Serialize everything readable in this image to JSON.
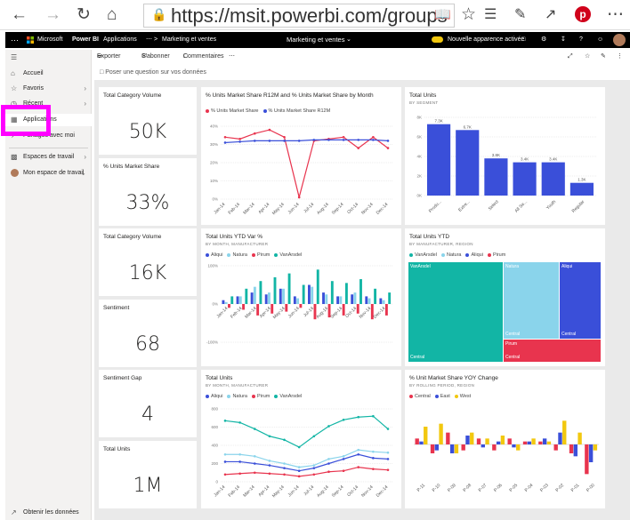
{
  "browser": {
    "url": "https://msit.powerbi.com/groups"
  },
  "topbar": {
    "microsoft": "Microsoft",
    "product": "Power BI",
    "crumb1": "Applications",
    "crumb2": "Marketing et ventes",
    "center_title": "Marketing et ventes",
    "toggle_label": "Nouvelle apparence activée"
  },
  "toolbar": {
    "export": "Exporter",
    "subscribe": "S'abonner",
    "comments": "Commentaires"
  },
  "qa": {
    "placeholder": "Poser une question sur vos données"
  },
  "sidebar": {
    "items": [
      {
        "label": "Accueil"
      },
      {
        "label": "Favoris"
      },
      {
        "label": "Récent"
      },
      {
        "label": "Applications"
      },
      {
        "label": "Partagés avec moi"
      },
      {
        "label": "Espaces de travail"
      },
      {
        "label": "Mon espace de travail"
      }
    ],
    "footer": "Obtenir les données"
  },
  "tiles": {
    "k1": {
      "title": "Total Category Volume",
      "value": "50K"
    },
    "k2": {
      "title": "% Units Market Share",
      "value": "33%"
    },
    "k3": {
      "title": "Total Category Volume",
      "value": "16K"
    },
    "k4": {
      "title": "Sentiment",
      "value": "68"
    },
    "k5": {
      "title": "Sentiment Gap",
      "value": "4"
    },
    "k6": {
      "title": "Total Units",
      "value": "1M"
    },
    "c1": {
      "title": "% Units Market Share R12M and % Units Market Share by Month",
      "legend": [
        "% Units Market Share",
        "% Units Market Share R12M"
      ]
    },
    "c2": {
      "title": "Total Units",
      "subtitle": "BY SEGMENT"
    },
    "c3": {
      "title": "Total Units YTD Var %",
      "subtitle": "BY MONTH, MANUFACTURER",
      "legend": [
        "Aliqui",
        "Natura",
        "Pirum",
        "VanArsdel"
      ]
    },
    "c4": {
      "title": "Total Units YTD",
      "subtitle": "BY MANUFACTURER, REGION",
      "legend": [
        "VanArsdel",
        "Natura",
        "Aliqui",
        "Pirum"
      ]
    },
    "c5": {
      "title": "Total Units",
      "subtitle": "BY MONTH, MANUFACTURER",
      "legend": [
        "Aliqui",
        "Natura",
        "Pirum",
        "VanArsdel"
      ]
    },
    "c6": {
      "title": "% Unit Market Share YOY Change",
      "subtitle": "BY ROLLING PERIOD, REGION",
      "legend": [
        "Central",
        "East",
        "West"
      ]
    }
  },
  "chart_data": [
    {
      "type": "line",
      "title": "% Units Market Share R12M and % Units Market Share by Month",
      "categories": [
        "Jan-14",
        "Feb-14",
        "Mar-14",
        "Apr-14",
        "May-14",
        "Jun-14",
        "Jul-14",
        "Aug-14",
        "Sep-14",
        "Oct-14",
        "Nov-14",
        "Dec-14"
      ],
      "ylim": [
        0,
        40
      ],
      "yticks": [
        "0%",
        "10%",
        "20%",
        "30%",
        "40%"
      ],
      "series": [
        {
          "name": "% Units Market Share",
          "color": "#e8344e",
          "values": [
            34,
            33,
            36,
            38,
            34,
            1,
            32,
            33,
            34,
            28,
            34,
            28
          ]
        },
        {
          "name": "% Units Market Share R12M",
          "color": "#3a4fd9",
          "values": [
            31,
            31.5,
            32,
            32,
            32,
            32,
            32.5,
            32.5,
            32.5,
            32.5,
            32.5,
            32
          ]
        }
      ]
    },
    {
      "type": "bar",
      "title": "Total Units",
      "subtitle": "BY SEGMENT",
      "categories": [
        "Produ...",
        "Extre...",
        "Select",
        "All Se...",
        "Youth",
        "Regular"
      ],
      "values": [
        7.3,
        6.7,
        3.8,
        3.4,
        3.4,
        1.3
      ],
      "data_labels": [
        "7.3K",
        "6.7K",
        "3.8K",
        "3.4K",
        "3.4K",
        "1.3K"
      ],
      "ylim": [
        0,
        8
      ],
      "yticks": [
        "0K",
        "2K",
        "4K",
        "6K",
        "8K"
      ],
      "color": "#3a4fd9"
    },
    {
      "type": "bar",
      "title": "Total Units YTD Var %",
      "subtitle": "BY MONTH, MANUFACTURER",
      "categories": [
        "Jan-14",
        "Feb-14",
        "Mar-14",
        "Apr-14",
        "May-14",
        "Jun-14",
        "Jul-14",
        "Aug-14",
        "Sep-14",
        "Oct-14",
        "Nov-14",
        "Dec-14"
      ],
      "ylim": [
        -100,
        100
      ],
      "yticks": [
        "-100%",
        "0%",
        "100%"
      ],
      "series": [
        {
          "name": "Aliqui",
          "color": "#3a4fd9",
          "values": [
            10,
            20,
            30,
            25,
            40,
            20,
            50,
            30,
            20,
            25,
            20,
            15
          ]
        },
        {
          "name": "Natura",
          "color": "#8ad4eb",
          "values": [
            5,
            20,
            45,
            30,
            40,
            15,
            45,
            25,
            20,
            30,
            15,
            10
          ]
        },
        {
          "name": "Pirum",
          "color": "#e8344e",
          "values": [
            -10,
            -15,
            -30,
            -25,
            -20,
            -10,
            -40,
            -35,
            -30,
            -25,
            -40,
            -30
          ]
        },
        {
          "name": "VanArsdel",
          "color": "#12b5a5",
          "values": [
            20,
            40,
            60,
            70,
            80,
            50,
            90,
            60,
            55,
            65,
            40,
            30
          ]
        }
      ]
    },
    {
      "type": "table",
      "title": "Total Units YTD",
      "subtitle": "BY MANUFACTURER, REGION",
      "treemap": [
        {
          "name": "VanArsdel",
          "color": "#12b5a5",
          "value": 48,
          "region": "Central"
        },
        {
          "name": "Natura",
          "color": "#8ad4eb",
          "value": 24,
          "region": "Central"
        },
        {
          "name": "Aliqui",
          "color": "#3a4fd9",
          "value": 15,
          "region": "Central"
        },
        {
          "name": "Pirum",
          "color": "#e8344e",
          "value": 8,
          "region": "Central"
        }
      ]
    },
    {
      "type": "line",
      "title": "Total Units",
      "subtitle": "BY MONTH, MANUFACTURER",
      "categories": [
        "Jan-14",
        "Feb-14",
        "Mar-14",
        "Apr-14",
        "May-14",
        "Jun-14",
        "Jul-14",
        "Aug-14",
        "Sep-14",
        "Oct-14",
        "Nov-14",
        "Dec-14"
      ],
      "ylim": [
        0,
        800
      ],
      "yticks": [
        "0",
        "200",
        "400",
        "600",
        "800"
      ],
      "series": [
        {
          "name": "Aliqui",
          "color": "#3a4fd9",
          "values": [
            220,
            220,
            200,
            180,
            150,
            120,
            150,
            200,
            250,
            300,
            260,
            250
          ]
        },
        {
          "name": "Natura",
          "color": "#8ad4eb",
          "values": [
            300,
            300,
            280,
            230,
            200,
            160,
            180,
            250,
            280,
            350,
            330,
            320
          ]
        },
        {
          "name": "Pirum",
          "color": "#e8344e",
          "values": [
            80,
            90,
            100,
            90,
            80,
            60,
            80,
            110,
            120,
            160,
            140,
            130
          ]
        },
        {
          "name": "VanArsdel",
          "color": "#12b5a5",
          "values": [
            670,
            650,
            580,
            500,
            460,
            380,
            500,
            610,
            680,
            710,
            720,
            580
          ]
        }
      ]
    },
    {
      "type": "bar",
      "title": "% Unit Market Share YOY Change",
      "subtitle": "BY ROLLING PERIOD, REGION",
      "categories": [
        "P-11",
        "P-10",
        "P-09",
        "P-08",
        "P-07",
        "P-06",
        "P-05",
        "P-04",
        "P-03",
        "P-02",
        "P-01",
        "P-00"
      ],
      "series": [
        {
          "name": "Central",
          "color": "#e8344e",
          "values": [
            2,
            -3,
            4,
            -2,
            2,
            -2,
            2,
            1,
            1,
            -2,
            -3,
            -10
          ]
        },
        {
          "name": "East",
          "color": "#3a4fd9",
          "values": [
            1,
            -2,
            -3,
            3,
            -1,
            1,
            -1,
            1,
            2,
            4,
            -4,
            -6
          ]
        },
        {
          "name": "West",
          "color": "#f2c80f",
          "values": [
            6,
            7,
            -3,
            4,
            2,
            3,
            -2,
            2,
            1,
            8,
            4,
            -2
          ]
        }
      ]
    }
  ]
}
